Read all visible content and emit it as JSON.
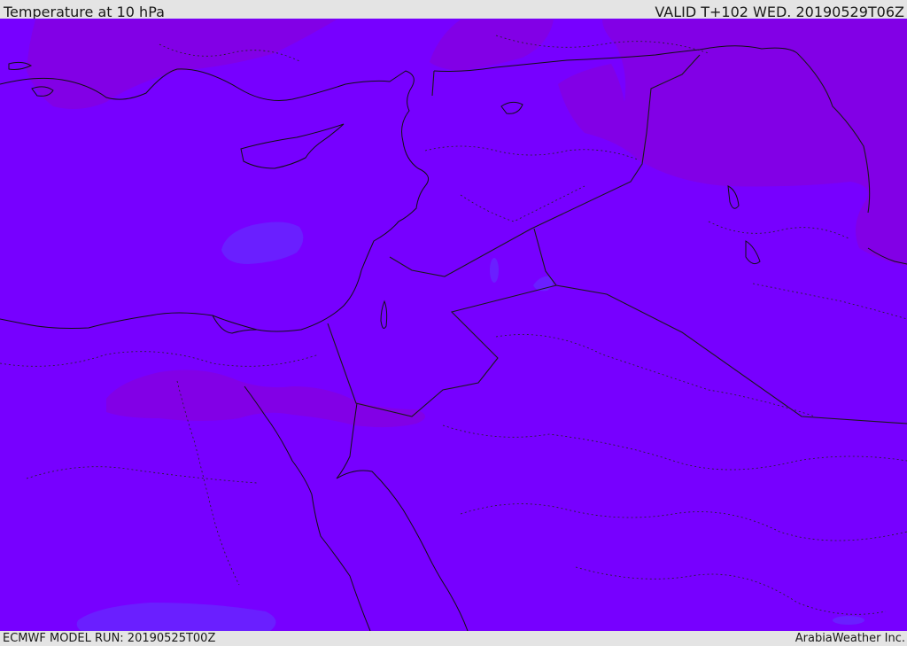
{
  "header": {
    "title": "Temperature at 10 hPa",
    "valid": "VALID T+102 WED. 20190529T06Z"
  },
  "footer": {
    "model_run": "ECMWF MODEL RUN: 20190525T00Z",
    "brand": "ArabiaWeather Inc."
  },
  "colors": {
    "background_field": "#7700ff",
    "warmer_field": "#8200e6",
    "cooler_field": "#6a1fff",
    "coastline": "#111111",
    "border": "#1a1a1a"
  }
}
